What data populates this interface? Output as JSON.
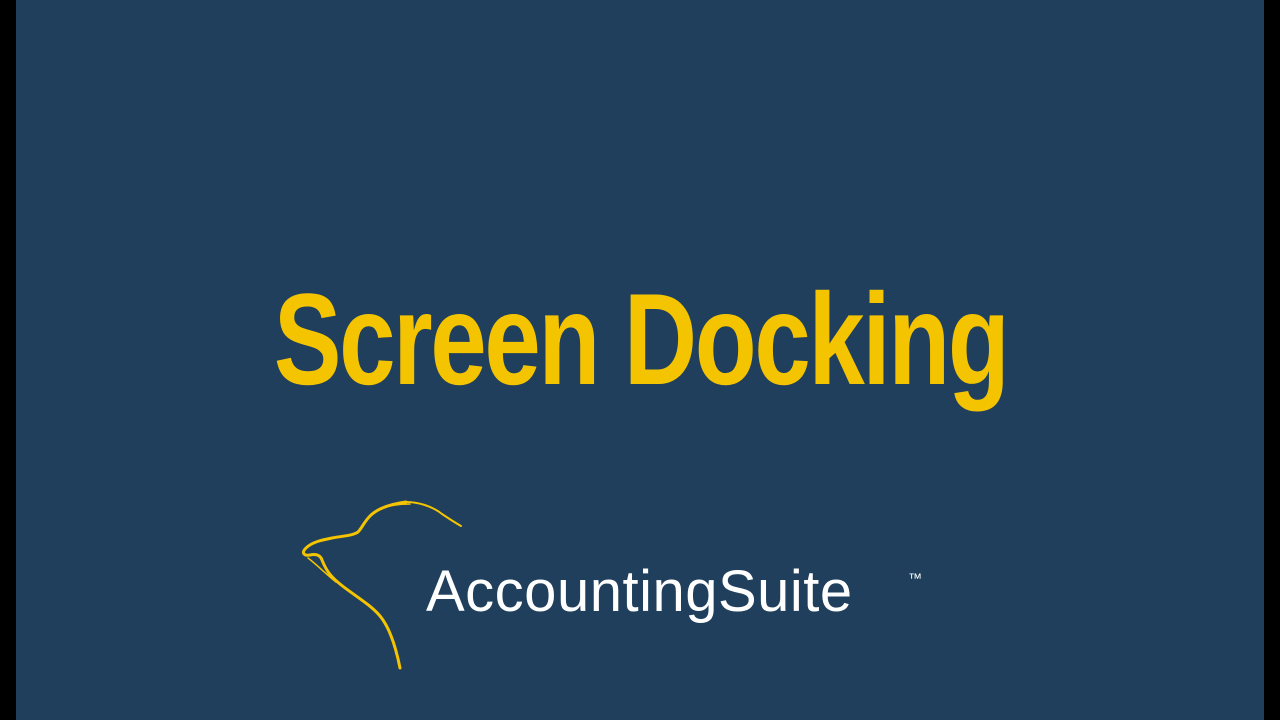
{
  "title": "Screen Docking",
  "logo": {
    "name": "AccountingSuite",
    "trademark": "™",
    "icon": "dog-head-outline-icon"
  },
  "colors": {
    "background": "#1f3f5c",
    "accent": "#f5c400",
    "text": "#ffffff",
    "border": "#000000"
  }
}
